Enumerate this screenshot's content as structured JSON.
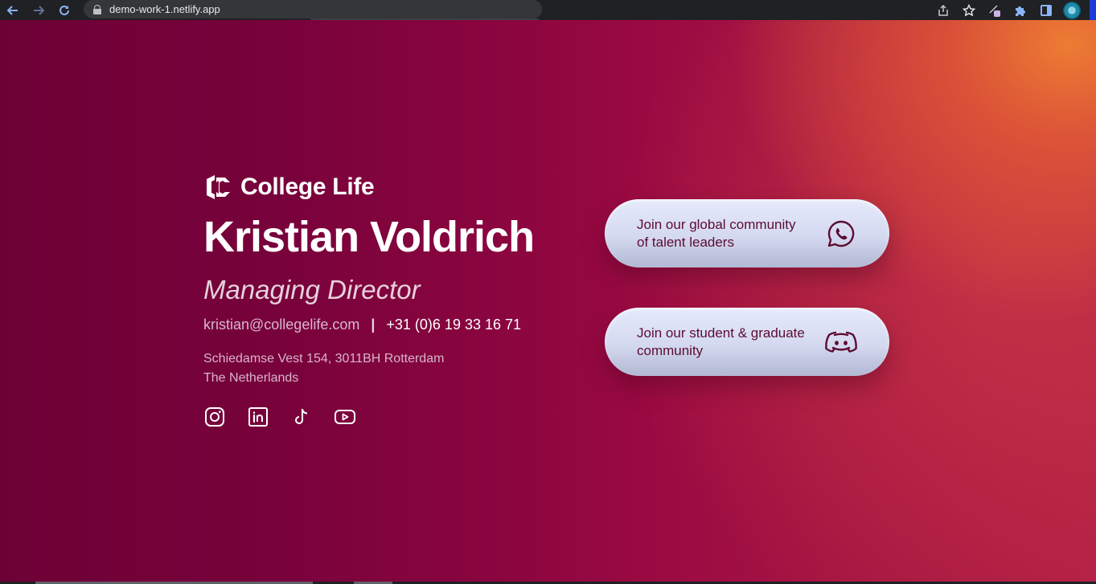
{
  "browser": {
    "url": "demo-work-1.netlify.app",
    "back_icon": "arrow-left-icon",
    "forward_icon": "arrow-right-icon",
    "reload_icon": "reload-icon",
    "toolbar_icons": [
      "share-icon",
      "star-icon",
      "extension-badge-icon",
      "puzzle-icon",
      "sidebar-icon",
      "profile-avatar"
    ]
  },
  "brand": {
    "logo_text": "College Life",
    "logo_icon": "college-life-logo-icon"
  },
  "person": {
    "name": "Kristian Voldrich",
    "title": "Managing Director",
    "email": "kristian@collegelife.com",
    "separator": "|",
    "phone": "+31 (0)6 19 33 16 71",
    "address_line1": "Schiedamse Vest 154, 3011BH Rotterdam",
    "address_line2": "The Netherlands"
  },
  "social": [
    "instagram-icon",
    "linkedin-icon",
    "tiktok-icon",
    "youtube-icon"
  ],
  "cta": [
    {
      "label": "Join our global community\nof talent leaders",
      "icon": "whatsapp-icon"
    },
    {
      "label": "Join our student & graduate\ncommunity",
      "icon": "discord-icon"
    }
  ],
  "colors": {
    "bg_left": "#6d0136",
    "bg_right_glow": "#f08032",
    "cta_text": "#5c0b32",
    "cta_bg": "#dde1f5"
  }
}
